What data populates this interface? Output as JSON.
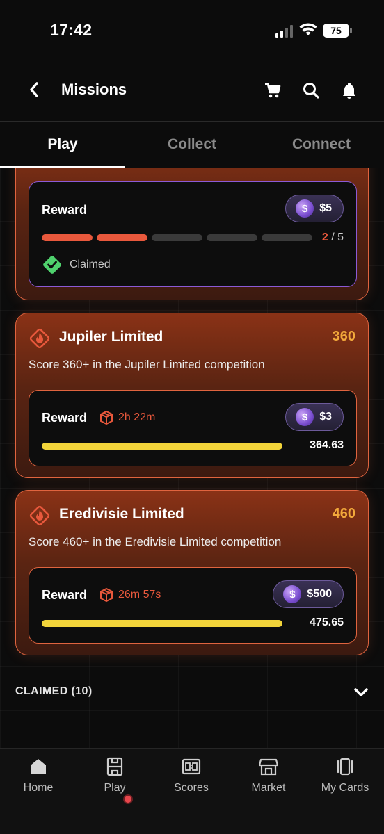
{
  "status_bar": {
    "time": "17:42",
    "battery": "75"
  },
  "header": {
    "title": "Missions",
    "icons": [
      "back-icon",
      "cart-icon",
      "search-icon",
      "bell-icon"
    ]
  },
  "tabs": [
    {
      "label": "Play",
      "active": true
    },
    {
      "label": "Collect",
      "active": false
    },
    {
      "label": "Connect",
      "active": false
    }
  ],
  "missions": [
    {
      "reward_label": "Reward",
      "reward_value": "$5",
      "progress_current": "2",
      "progress_sep": " / 5",
      "progress_fraction": 0.4,
      "segments_total": 5,
      "segments_done": 2,
      "status": "Claimed"
    },
    {
      "name": "Jupiler Limited",
      "target": "360",
      "description": "Score 360+ in the Jupiler Limited competition",
      "reward_label": "Reward",
      "timer": "2h 22m",
      "reward_value": "$3",
      "score": "364.63",
      "progress_fraction": 1.0
    },
    {
      "name": "Eredivisie Limited",
      "target": "460",
      "description": "Score 460+ in the Eredivisie Limited competition",
      "reward_label": "Reward",
      "timer": "26m 57s",
      "reward_value": "$500",
      "score": "475.65",
      "progress_fraction": 1.0
    }
  ],
  "claimed_section": {
    "label": "CLAIMED (10)"
  },
  "bottom_nav": [
    {
      "label": "Home",
      "icon": "home-icon"
    },
    {
      "label": "Play",
      "icon": "play-icon",
      "notification": true
    },
    {
      "label": "Scores",
      "icon": "scores-icon"
    },
    {
      "label": "Market",
      "icon": "market-icon"
    },
    {
      "label": "My Cards",
      "icon": "cards-icon"
    }
  ],
  "colors": {
    "accent": "#e8583c",
    "target": "#f2a93b",
    "progress": "#f2d43a",
    "claimed_border": "#8b5ad6",
    "check": "#4fd16d"
  }
}
